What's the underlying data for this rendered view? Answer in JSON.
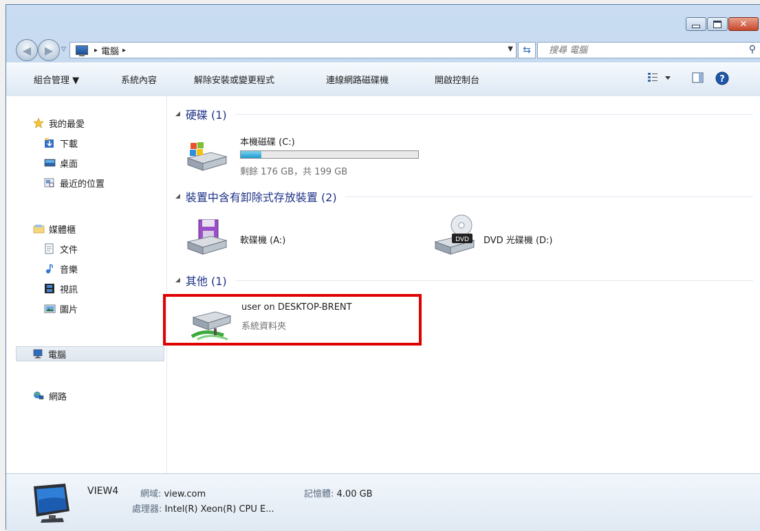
{
  "address": {
    "crumbs": [
      "電腦"
    ],
    "separator": "▸"
  },
  "search": {
    "placeholder": "搜尋 電腦"
  },
  "toolbar": {
    "organize": "組合管理 ▼",
    "system_properties": "系統內容",
    "uninstall": "解除安裝或變更程式",
    "map_drive": "連線網路磁碟機",
    "control_panel": "開啟控制台"
  },
  "sidebar": {
    "favorites": "我的最愛",
    "downloads": "下載",
    "desktop": "桌面",
    "recent": "最近的位置",
    "libraries": "媒體櫃",
    "documents": "文件",
    "music": "音樂",
    "videos": "視訊",
    "pictures": "圖片",
    "computer": "電腦",
    "network": "網路"
  },
  "groups": {
    "hard_disks": "硬碟 (1)",
    "removable": "裝置中含有卸除式存放裝置 (2)",
    "other": "其他 (1)"
  },
  "drives": {
    "c": {
      "name": "本機磁碟 (C:)",
      "free": "剩餘 176 GB，共 199 GB",
      "used_fraction": 0.115
    },
    "a": {
      "name": "軟碟機 (A:)"
    },
    "d": {
      "name": "DVD 光碟機 (D:)",
      "badge": "DVD"
    },
    "share": {
      "name": "user on DESKTOP-BRENT",
      "type": "系統資料夾"
    }
  },
  "details": {
    "name": "VIEW4",
    "domain_label": "網域:",
    "domain_value": "view.com",
    "memory_label": "記憶體:",
    "memory_value": "4.00 GB",
    "cpu_label": "處理器:",
    "cpu_value": "Intel(R) Xeon(R) CPU E..."
  },
  "colors": {
    "highlight_box": "#e00000",
    "group_header": "#1e3287",
    "capacity_fill": "#1c9ad0"
  }
}
